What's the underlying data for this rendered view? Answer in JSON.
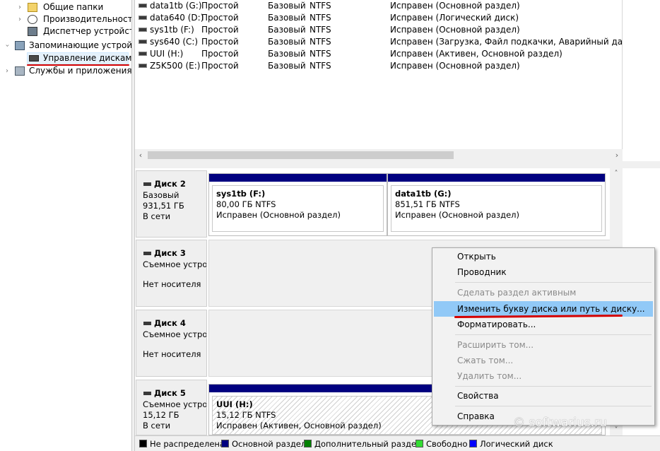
{
  "tree": {
    "items": [
      {
        "label": "Общие папки",
        "icon": "shared-folder-icon"
      },
      {
        "label": "Производительность",
        "icon": "performance-icon"
      },
      {
        "label": "Диспетчер устройств",
        "icon": "device-manager-icon"
      },
      {
        "label": "Запоминающие устройст",
        "icon": "storage-icon"
      },
      {
        "label": "Управление дисками",
        "icon": "disk-management-icon"
      },
      {
        "label": "Службы и приложения",
        "icon": "services-icon"
      }
    ]
  },
  "volumes": {
    "rows": [
      {
        "name": "data1tb (G:)",
        "layout": "Простой",
        "type": "Базовый",
        "fs": "NTFS",
        "status": "Исправен (Основной раздел)"
      },
      {
        "name": "data640 (D:)",
        "layout": "Простой",
        "type": "Базовый",
        "fs": "NTFS",
        "status": "Исправен (Логический диск)"
      },
      {
        "name": "sys1tb (F:)",
        "layout": "Простой",
        "type": "Базовый",
        "fs": "NTFS",
        "status": "Исправен (Основной раздел)"
      },
      {
        "name": "sys640 (C:)",
        "layout": "Простой",
        "type": "Базовый",
        "fs": "NTFS",
        "status": "Исправен (Загрузка, Файл подкачки, Аварийный дамп пам"
      },
      {
        "name": "UUI (H:)",
        "layout": "Простой",
        "type": "Базовый",
        "fs": "NTFS",
        "status": "Исправен (Активен, Основной раздел)"
      },
      {
        "name": "Z5K500 (E:)",
        "layout": "Простой",
        "type": "Базовый",
        "fs": "NTFS",
        "status": "Исправен (Основной раздел)"
      }
    ]
  },
  "disks": {
    "disk2": {
      "name": "Диск 2",
      "type": "Базовый",
      "size": "931,51 ГБ",
      "state": "В сети",
      "p1": {
        "name": "sys1tb  (F:)",
        "size": "80,00 ГБ NTFS",
        "status": "Исправен (Основной раздел)"
      },
      "p2": {
        "name": "data1tb  (G:)",
        "size": "851,51 ГБ NTFS",
        "status": "Исправен (Основной раздел)"
      }
    },
    "disk3": {
      "name": "Диск 3",
      "type": "Съемное устрой",
      "state": "Нет носителя"
    },
    "disk4": {
      "name": "Диск 4",
      "type": "Съемное устрой",
      "state": "Нет носителя"
    },
    "disk5": {
      "name": "Диск 5",
      "type": "Съемное устрой",
      "size": "15,12 ГБ",
      "state": "В сети",
      "p1": {
        "name": "UUI  (H:)",
        "size": "15,12 ГБ NTFS",
        "status": "Исправен (Активен, Основной раздел)"
      }
    }
  },
  "legend": [
    {
      "label": "Не распределена",
      "color": "#000000"
    },
    {
      "label": "Основной раздел",
      "color": "#000080"
    },
    {
      "label": "Дополнительный раздел",
      "color": "#008000"
    },
    {
      "label": "Свободно",
      "color": "#33dd33"
    },
    {
      "label": "Логический диск",
      "color": "#0000ff"
    }
  ],
  "menu": {
    "open": "Открыть",
    "explorer": "Проводник",
    "make_active": "Сделать раздел активным",
    "change_letter": "Изменить букву диска или путь к диску...",
    "format": "Форматировать...",
    "extend": "Расширить том...",
    "shrink": "Сжать том...",
    "delete": "Удалить том...",
    "properties": "Свойства",
    "help": "Справка"
  },
  "watermark": "© softwarius.ru"
}
